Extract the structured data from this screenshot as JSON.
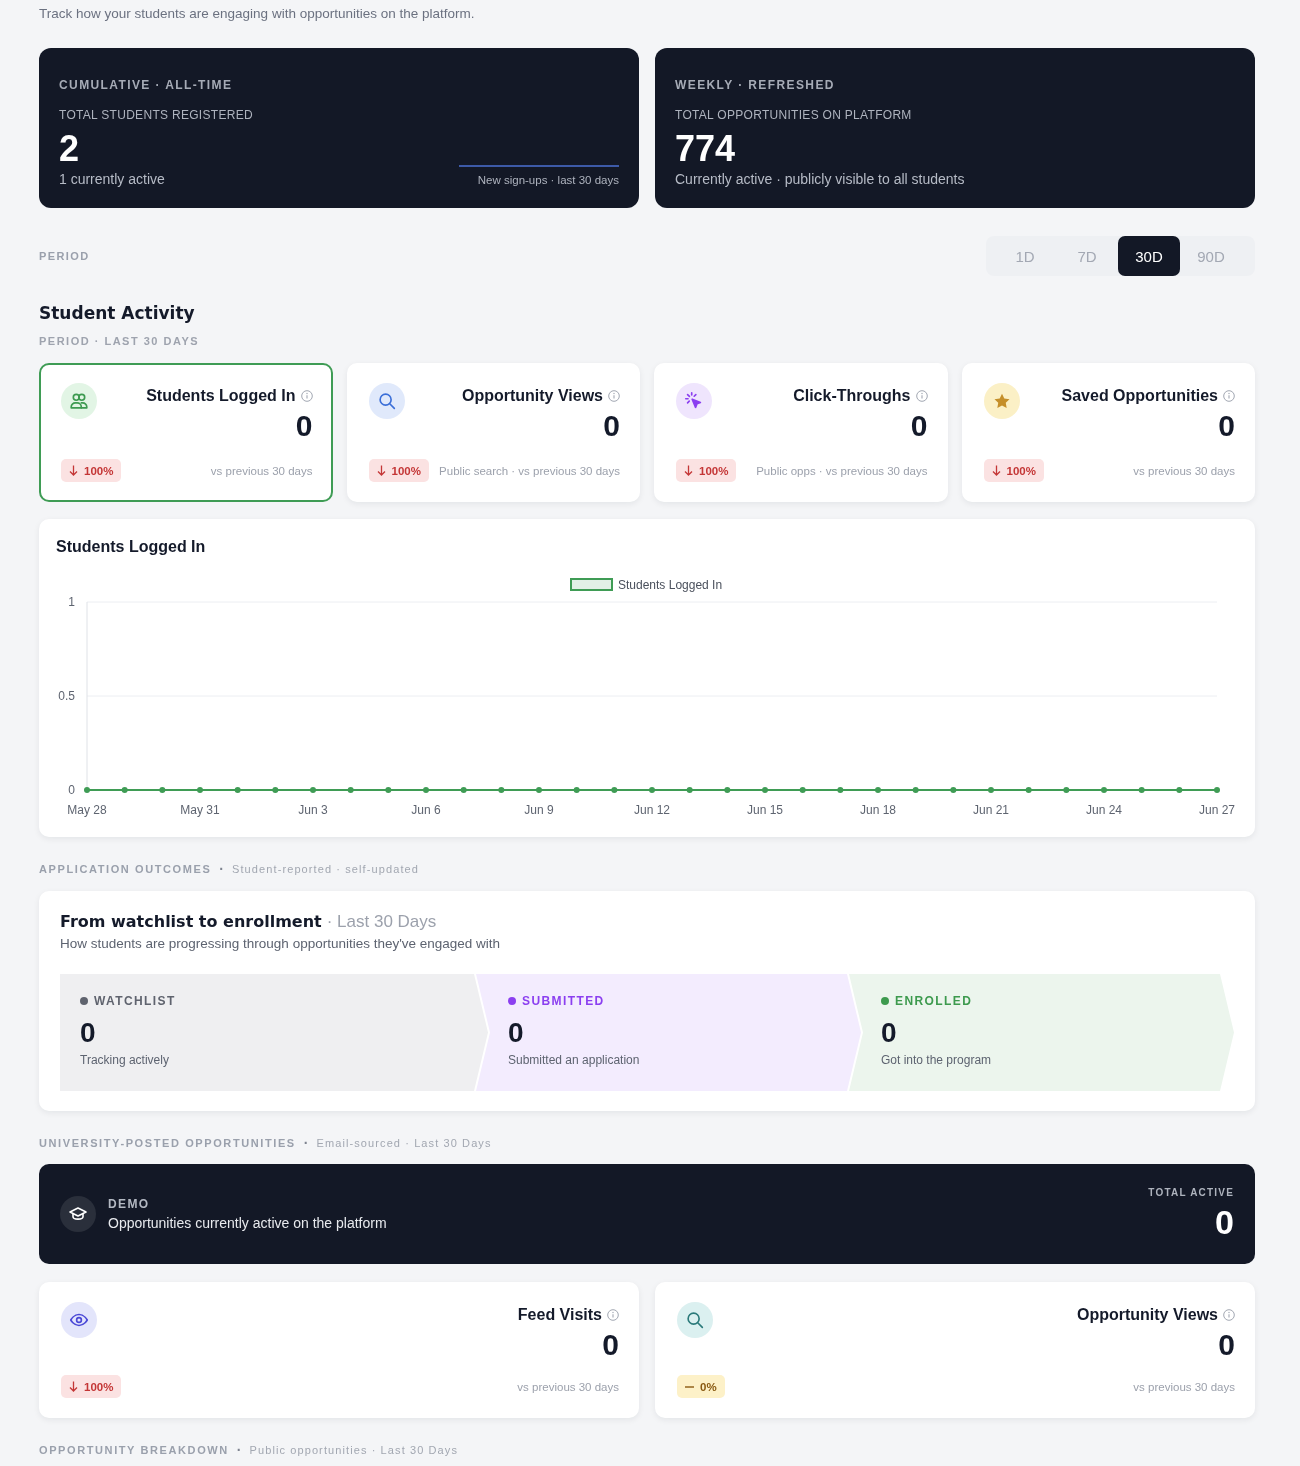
{
  "intro": "Track how your students are engaging with opportunities on the platform.",
  "summary_cards": [
    {
      "eyebrow": "CUMULATIVE · ALL-TIME",
      "label": "TOTAL STUDENTS REGISTERED",
      "value": "2",
      "caption": "1 currently active",
      "sparkline_caption": "New sign-ups · last 30 days"
    },
    {
      "eyebrow": "WEEKLY · REFRESHED",
      "label": "TOTAL OPPORTUNITIES ON PLATFORM",
      "value": "774",
      "caption": "Currently active · publicly visible to all students"
    }
  ],
  "period": {
    "label": "PERIOD",
    "options": [
      {
        "label": "1D",
        "selected": false
      },
      {
        "label": "7D",
        "selected": false
      },
      {
        "label": "30D",
        "selected": true
      },
      {
        "label": "90D",
        "selected": false
      }
    ]
  },
  "student_activity": {
    "title": "Student Activity",
    "subtitle": "PERIOD · LAST 30 DAYS",
    "metrics": [
      {
        "kind": "logins",
        "title": "Students Logged In",
        "value": "0",
        "change": {
          "kind": "down",
          "text": "100%"
        },
        "note": "vs previous 30 days",
        "selected": true
      },
      {
        "kind": "views",
        "title": "Opportunity Views",
        "value": "0",
        "change": {
          "kind": "down",
          "text": "100%"
        },
        "note": "Public search · vs previous 30 days",
        "selected": false
      },
      {
        "kind": "clicks",
        "title": "Click-Throughs",
        "value": "0",
        "change": {
          "kind": "down",
          "text": "100%"
        },
        "note": "Public opps · vs previous 30 days",
        "selected": false
      },
      {
        "kind": "saved",
        "title": "Saved Opportunities",
        "value": "0",
        "change": {
          "kind": "down",
          "text": "100%"
        },
        "note": "vs previous 30 days",
        "selected": false
      }
    ],
    "chart": {
      "chart_data": {
        "type": "line",
        "title": "Students Logged In",
        "categories": [
          "May 28",
          null,
          null,
          "May 31",
          null,
          null,
          "Jun 3",
          null,
          null,
          "Jun 6",
          null,
          null,
          "Jun 9",
          null,
          null,
          "Jun 12",
          null,
          null,
          "Jun 15",
          null,
          null,
          "Jun 18",
          null,
          null,
          "Jun 21",
          null,
          null,
          "Jun 24",
          null,
          null,
          "Jun 27"
        ],
        "ylim": [
          0,
          1
        ],
        "yticks": [
          0,
          0.5,
          1
        ],
        "series": [
          {
            "name": "Students Logged In",
            "color": "#3f9c55",
            "marker": "circle",
            "values": [
              0,
              0,
              0,
              0,
              0,
              0,
              0,
              0,
              0,
              0,
              0,
              0,
              0,
              0,
              0,
              0,
              0,
              0,
              0,
              0,
              0,
              0,
              0,
              0,
              0,
              0,
              0,
              0,
              0,
              0,
              0
            ]
          }
        ]
      }
    }
  },
  "application_outcomes": {
    "title": "APPLICATION OUTCOMES",
    "separator": "·",
    "note": "Student-reported · self-updated",
    "card": {
      "title": "From watchlist to enrollment",
      "period": "· Last 30 Days",
      "subtitle": "How students are progressing through opportunities they've engaged with",
      "stages": [
        {
          "label": "WATCHLIST",
          "color": "#5f636e",
          "value": "0",
          "description": "Tracking actively"
        },
        {
          "label": "SUBMITTED",
          "color": "#8b3ff0",
          "value": "0",
          "description": "Submitted an application"
        },
        {
          "label": "ENROLLED",
          "color": "#3d9a4e",
          "value": "0",
          "description": "Got into the program"
        }
      ]
    }
  },
  "university_posted": {
    "title": "UNIVERSITY-POSTED OPPORTUNITIES",
    "separator": "·",
    "note": "Email-sourced · Last 30 Days",
    "banner": {
      "label": "DEMO",
      "text": "Opportunities currently active on the platform",
      "total_label": "TOTAL ACTIVE",
      "total": "0"
    },
    "metrics": [
      {
        "kind": "visits",
        "title": "Feed Visits",
        "value": "0",
        "change": {
          "kind": "down",
          "text": "100%"
        },
        "note": "vs previous 30 days"
      },
      {
        "kind": "views",
        "title": "Opportunity Views",
        "value": "0",
        "change": {
          "kind": "flat",
          "text": "0%"
        },
        "note": "vs previous 30 days"
      }
    ]
  },
  "opportunity_breakdown": {
    "title": "OPPORTUNITY BREAKDOWN",
    "separator": "·",
    "note": "Public opportunities · Last 30 Days"
  }
}
